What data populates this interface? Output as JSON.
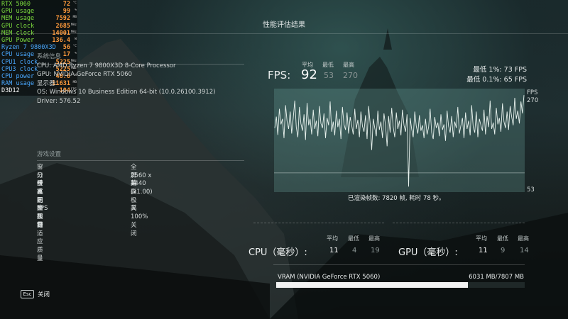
{
  "hud": {
    "rows": [
      {
        "label": "RTX 5060",
        "value": "72",
        "unit": "°C",
        "color": "green"
      },
      {
        "label": "GPU usage",
        "value": "99",
        "unit": "%",
        "color": "green"
      },
      {
        "label": "MEM  usage",
        "value": "7592",
        "unit": "MB",
        "color": "green"
      },
      {
        "label": "GPU clock",
        "value": "2685",
        "unit": "MHz",
        "color": "green"
      },
      {
        "label": "MEM clock",
        "value": "14001",
        "unit": "MHz",
        "color": "green"
      },
      {
        "label": "GPU Power",
        "value": "136.4",
        "unit": "W",
        "color": "green"
      },
      {
        "label": "Ryzen 7 9800X3D",
        "value": "56",
        "unit": "°C",
        "color": "blue"
      },
      {
        "label": "CPU usage",
        "value": "17",
        "unit": "%",
        "color": "blue"
      },
      {
        "label": "CPU1 clock",
        "value": "5225",
        "unit": "MHz",
        "color": "blue"
      },
      {
        "label": "CPU3 clock",
        "value": "5225",
        "unit": "MHz",
        "color": "blue"
      },
      {
        "label": "CPU power",
        "value": "48.6",
        "unit": "W",
        "color": "blue"
      },
      {
        "label": "RAM usage",
        "value": "11631",
        "unit": "MB",
        "color": "blue"
      },
      {
        "label": "D3D12",
        "value": "104",
        "unit": "FPS",
        "color": "white"
      }
    ]
  },
  "title": "性能评估结果",
  "system_info": {
    "section_label": "系统信息",
    "cpu": "CPU: AMD Ryzen 7 9800X3D 8-Core Processor",
    "gpu": "GPU: NVIDIA GeForce RTX 5060",
    "display": "显示器: ",
    "os": "OS: Windows 10 Business Edition 64-bit (10.0.26100.3912)",
    "driver": "Driver: 576.52"
  },
  "settings": {
    "heading": "游戏设置",
    "rows": [
      {
        "key": "窗口模式",
        "value": "全屏幕"
      },
      {
        "key": "分辨率",
        "value": "2560 x 1440 (x1.00)"
      },
      {
        "key": "垂直同步",
        "value": "关"
      },
      {
        "key": "反锯齿",
        "value": "高"
      },
      {
        "key": "画面质量",
        "value": "极高"
      },
      {
        "key": "FPS 限制",
        "value": "关"
      },
      {
        "key": "视野",
        "value": "100%"
      },
      {
        "key": "自适应质量",
        "value": "关闭"
      }
    ]
  },
  "fps": {
    "label": "FPS:",
    "avg_head": "平均",
    "min_head": "最低",
    "max_head": "最高",
    "avg": "92",
    "min": "53",
    "max": "270",
    "low1": "最低 1%:  73 FPS",
    "low01": "最低 0.1%:  65 FPS"
  },
  "chart_labels": {
    "unit": "FPS",
    "top": "270",
    "bottom": "53"
  },
  "chart_data": {
    "type": "line",
    "xlabel": "",
    "ylabel": "FPS",
    "ylim": [
      53,
      270
    ],
    "series": [
      {
        "values": [
          190,
          215,
          175,
          232,
          198,
          210,
          168,
          240,
          205,
          188,
          226,
          178,
          212,
          250,
          192,
          170,
          236,
          200,
          184,
          220,
          164,
          245,
          196,
          210,
          176,
          230,
          188,
          206,
          172,
          238,
          200,
          190,
          222,
          168,
          212,
          196,
          248,
          182,
          204,
          174,
          228,
          192,
          210,
          166,
          236,
          198,
          186,
          224,
          178,
          214,
          196,
          176,
          232,
          188,
          208,
          170,
          226,
          194,
          182,
          218,
          166,
          238,
          200,
          142,
          210,
          190,
          172,
          228,
          186,
          204,
          168,
          222,
          196,
          150,
          216,
          180,
          234,
          192,
          170,
          224,
          188,
          206,
          174,
          230,
          196,
          182,
          220,
          62,
          212,
          188,
          170,
          226,
          194,
          178,
          218,
          184,
          196,
          168,
          210,
          176,
          192,
          232,
          180,
          166,
          214,
          190,
          202,
          172,
          220,
          186,
          198,
          162,
          228,
          194,
          180,
          216,
          170,
          204,
          190,
          236,
          178,
          196,
          212,
          168,
          224,
          188,
          206,
          174,
          240,
          192,
          180,
          226,
          170,
          210,
          196,
          184,
          230,
          176,
          216,
          192,
          250,
          188,
          202,
          176,
          234,
          198,
          212,
          182,
          244,
          204,
          190,
          226,
          186,
          238,
          214,
          196,
          256,
          210,
          228,
          200,
          248,
          222,
          262
        ]
      }
    ]
  },
  "frames_summary": "已渲染帧数: 7820 帧, 耗时 78 秒。",
  "cpu_stats": {
    "label": "CPU（毫秒）:",
    "avg_head": "平均",
    "min_head": "最低",
    "max_head": "最高",
    "avg": "11",
    "min": "4",
    "max": "19"
  },
  "gpu_stats": {
    "label": "GPU（毫秒）:",
    "avg_head": "平均",
    "min_head": "最低",
    "max_head": "最高",
    "avg": "11",
    "min": "9",
    "max": "14"
  },
  "vram": {
    "label": "VRAM (NVIDIA GeForce RTX 5060)",
    "value": "6031 MB/7807 MB",
    "used": 6031,
    "total": 7807
  },
  "footer": {
    "esc_key": "Esc",
    "esc_label": "关闭"
  },
  "colors": {
    "green": "#7ddc3e",
    "blue": "#4aa8ff",
    "white": "#ffffff",
    "line": "#e8f2ee",
    "unit_orange": "#ff9a3c"
  }
}
